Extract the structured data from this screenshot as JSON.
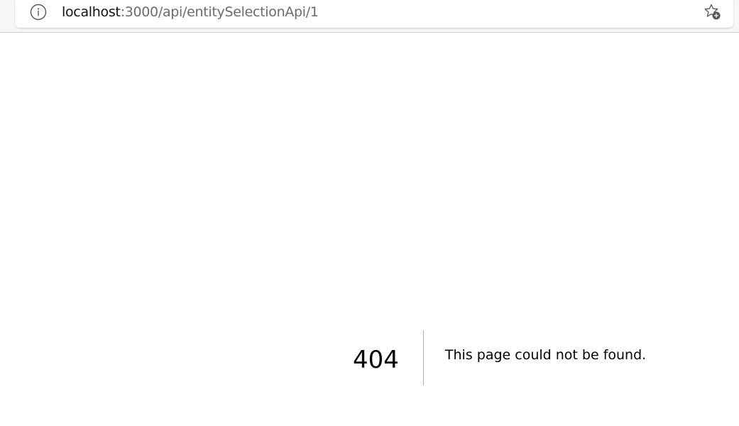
{
  "address_bar": {
    "url_host": "localhost",
    "url_path": ":3000/api/entitySelectionApi/1",
    "site_info_icon": "info-circle",
    "favorite_icon": "star-add"
  },
  "error_page": {
    "code": "404",
    "message": "This page could not be found."
  },
  "colors": {
    "url_host": "#111111",
    "url_path": "#6b6b6b",
    "text": "#000000",
    "background": "#ffffff"
  }
}
